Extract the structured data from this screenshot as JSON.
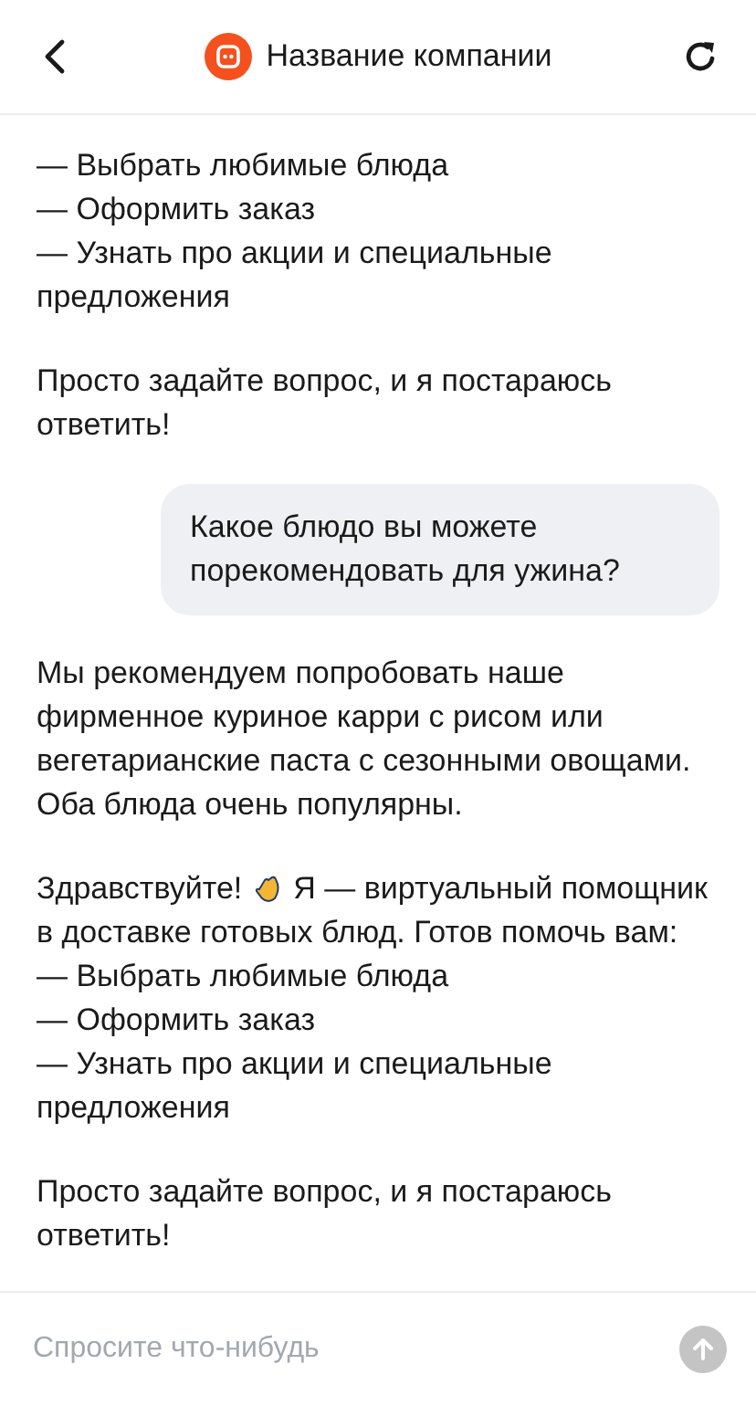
{
  "header": {
    "title": "Название компании"
  },
  "messages": [
    {
      "kind": "bot",
      "paragraphs": [
        {
          "text": "— Выбрать любимые блюда\n— Оформить заказ\n— Узнать про акции и специальные предложения"
        },
        {
          "text": "Просто задайте вопрос, и я постараюсь ответить!"
        }
      ]
    },
    {
      "kind": "user",
      "paragraphs": [
        {
          "text": "Какое блюдо вы можете порекомендовать для ужина?"
        }
      ]
    },
    {
      "kind": "bot",
      "paragraphs": [
        {
          "text": "Мы рекомендуем попробовать наше фирменное куриное карри с рисом или вегетарианские паста с сезонными овощами. Оба блюда очень популярны."
        },
        {
          "lead": "Здравствуйте!",
          "first_line": "Я — виртуальный помощник",
          "text": "в доставке готовых блюд. Готов помочь вам:\n— Выбрать любимые блюда\n— Оформить заказ\n— Узнать про акции и специальные предложения"
        },
        {
          "text": "Просто задайте вопрос, и я постараюсь ответить!"
        }
      ]
    }
  ],
  "composer": {
    "placeholder": "Спросите что-нибудь"
  }
}
